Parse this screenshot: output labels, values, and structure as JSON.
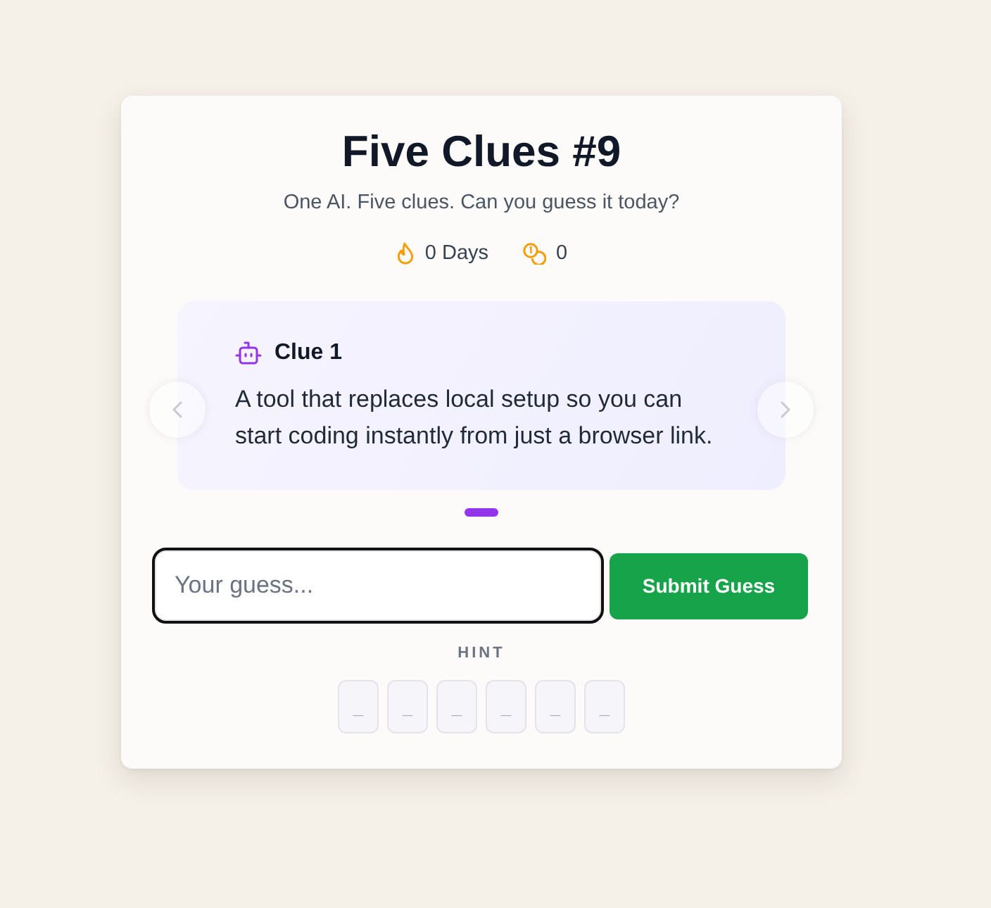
{
  "header": {
    "title": "Five Clues #9",
    "subtitle": "One AI. Five clues. Can you guess it today?"
  },
  "stats": [
    {
      "kind": "streak",
      "value": "0 Days"
    },
    {
      "kind": "coins",
      "value": "0"
    }
  ],
  "clue_carousel": {
    "clue": {
      "title": "Clue 1",
      "text": "A tool that replaces local setup so you can start coding instantly from just a browser link."
    },
    "dots": [
      {
        "selected": true
      }
    ]
  },
  "guess": {
    "placeholder": "Your guess...",
    "focused": true,
    "submit": "Submit Guess"
  },
  "hint": {
    "label": "HINT",
    "letters": [
      "_",
      "_",
      "_",
      "_",
      "_",
      "_"
    ]
  }
}
